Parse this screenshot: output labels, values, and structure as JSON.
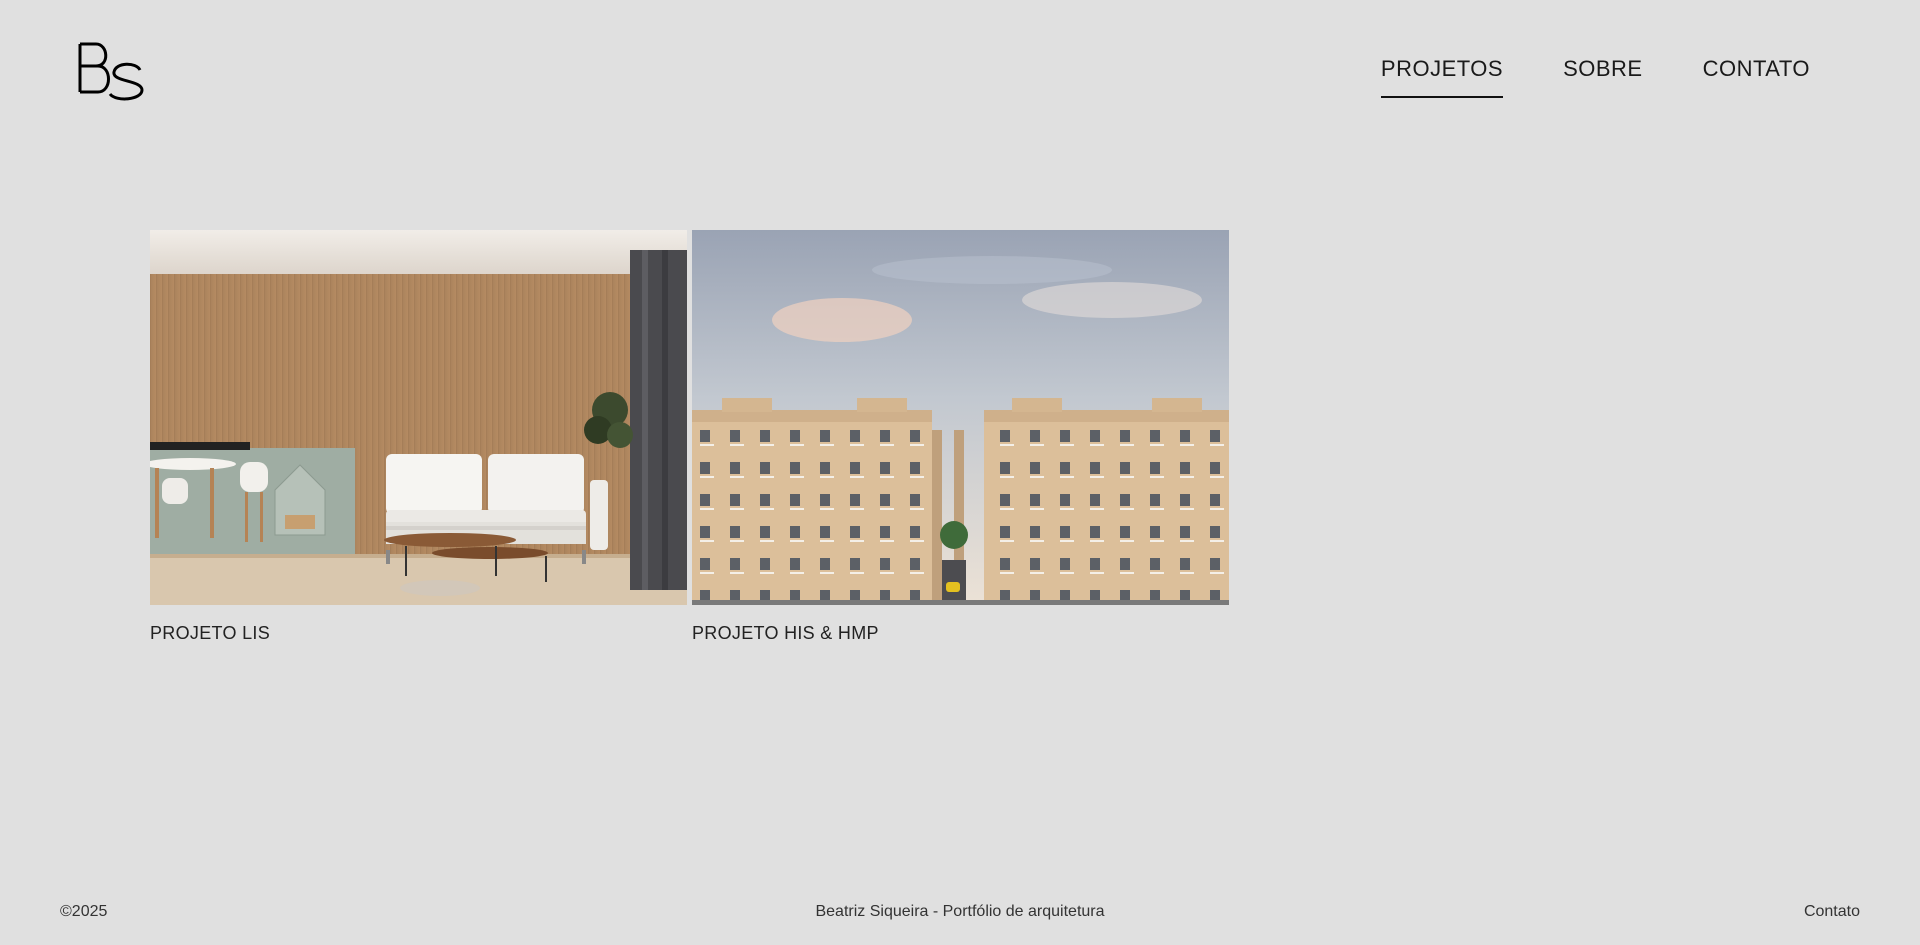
{
  "brand": {
    "logo_text": "BS"
  },
  "nav": {
    "items": [
      {
        "label": "PROJETOS",
        "active": true
      },
      {
        "label": "SOBRE",
        "active": false
      },
      {
        "label": "CONTATO",
        "active": false
      }
    ]
  },
  "projects": [
    {
      "title": "PROJETO LIS",
      "image": "living room interior render with white sofa and wood panel wall"
    },
    {
      "title": "PROJETO HIS & HMP",
      "image": "residential apartment buildings exterior render with sky"
    }
  ],
  "footer": {
    "copyright": "©2025",
    "center_text": "Beatriz Siqueira - Portfólio de arquitetura",
    "contact_label": "Contato"
  }
}
